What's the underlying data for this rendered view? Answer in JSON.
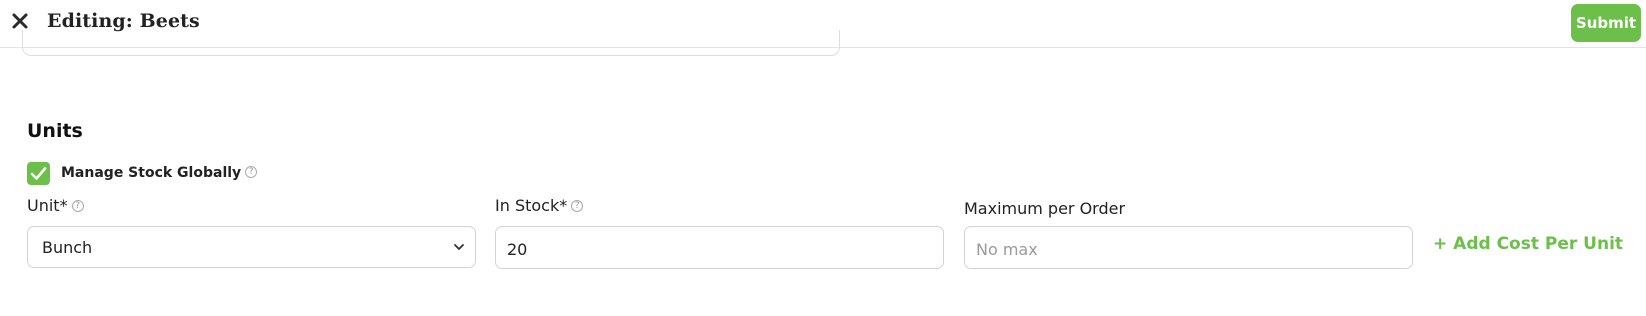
{
  "header": {
    "title": "Editing: Beets",
    "submit_label": "Submit",
    "close_icon": "close-icon"
  },
  "colors": {
    "accent": "#6cc04a",
    "border": "#d4d4d4",
    "text": "#222222"
  },
  "units": {
    "section_title": "Units",
    "manage_stock": {
      "label": "Manage Stock Globally",
      "checked": true
    },
    "unit": {
      "label": "Unit*",
      "value": "Bunch"
    },
    "in_stock": {
      "label": "In Stock*",
      "value": "20"
    },
    "max_per_order": {
      "label": "Maximum per Order",
      "placeholder": "No max"
    },
    "add_cost_label": "+ Add Cost Per Unit"
  }
}
